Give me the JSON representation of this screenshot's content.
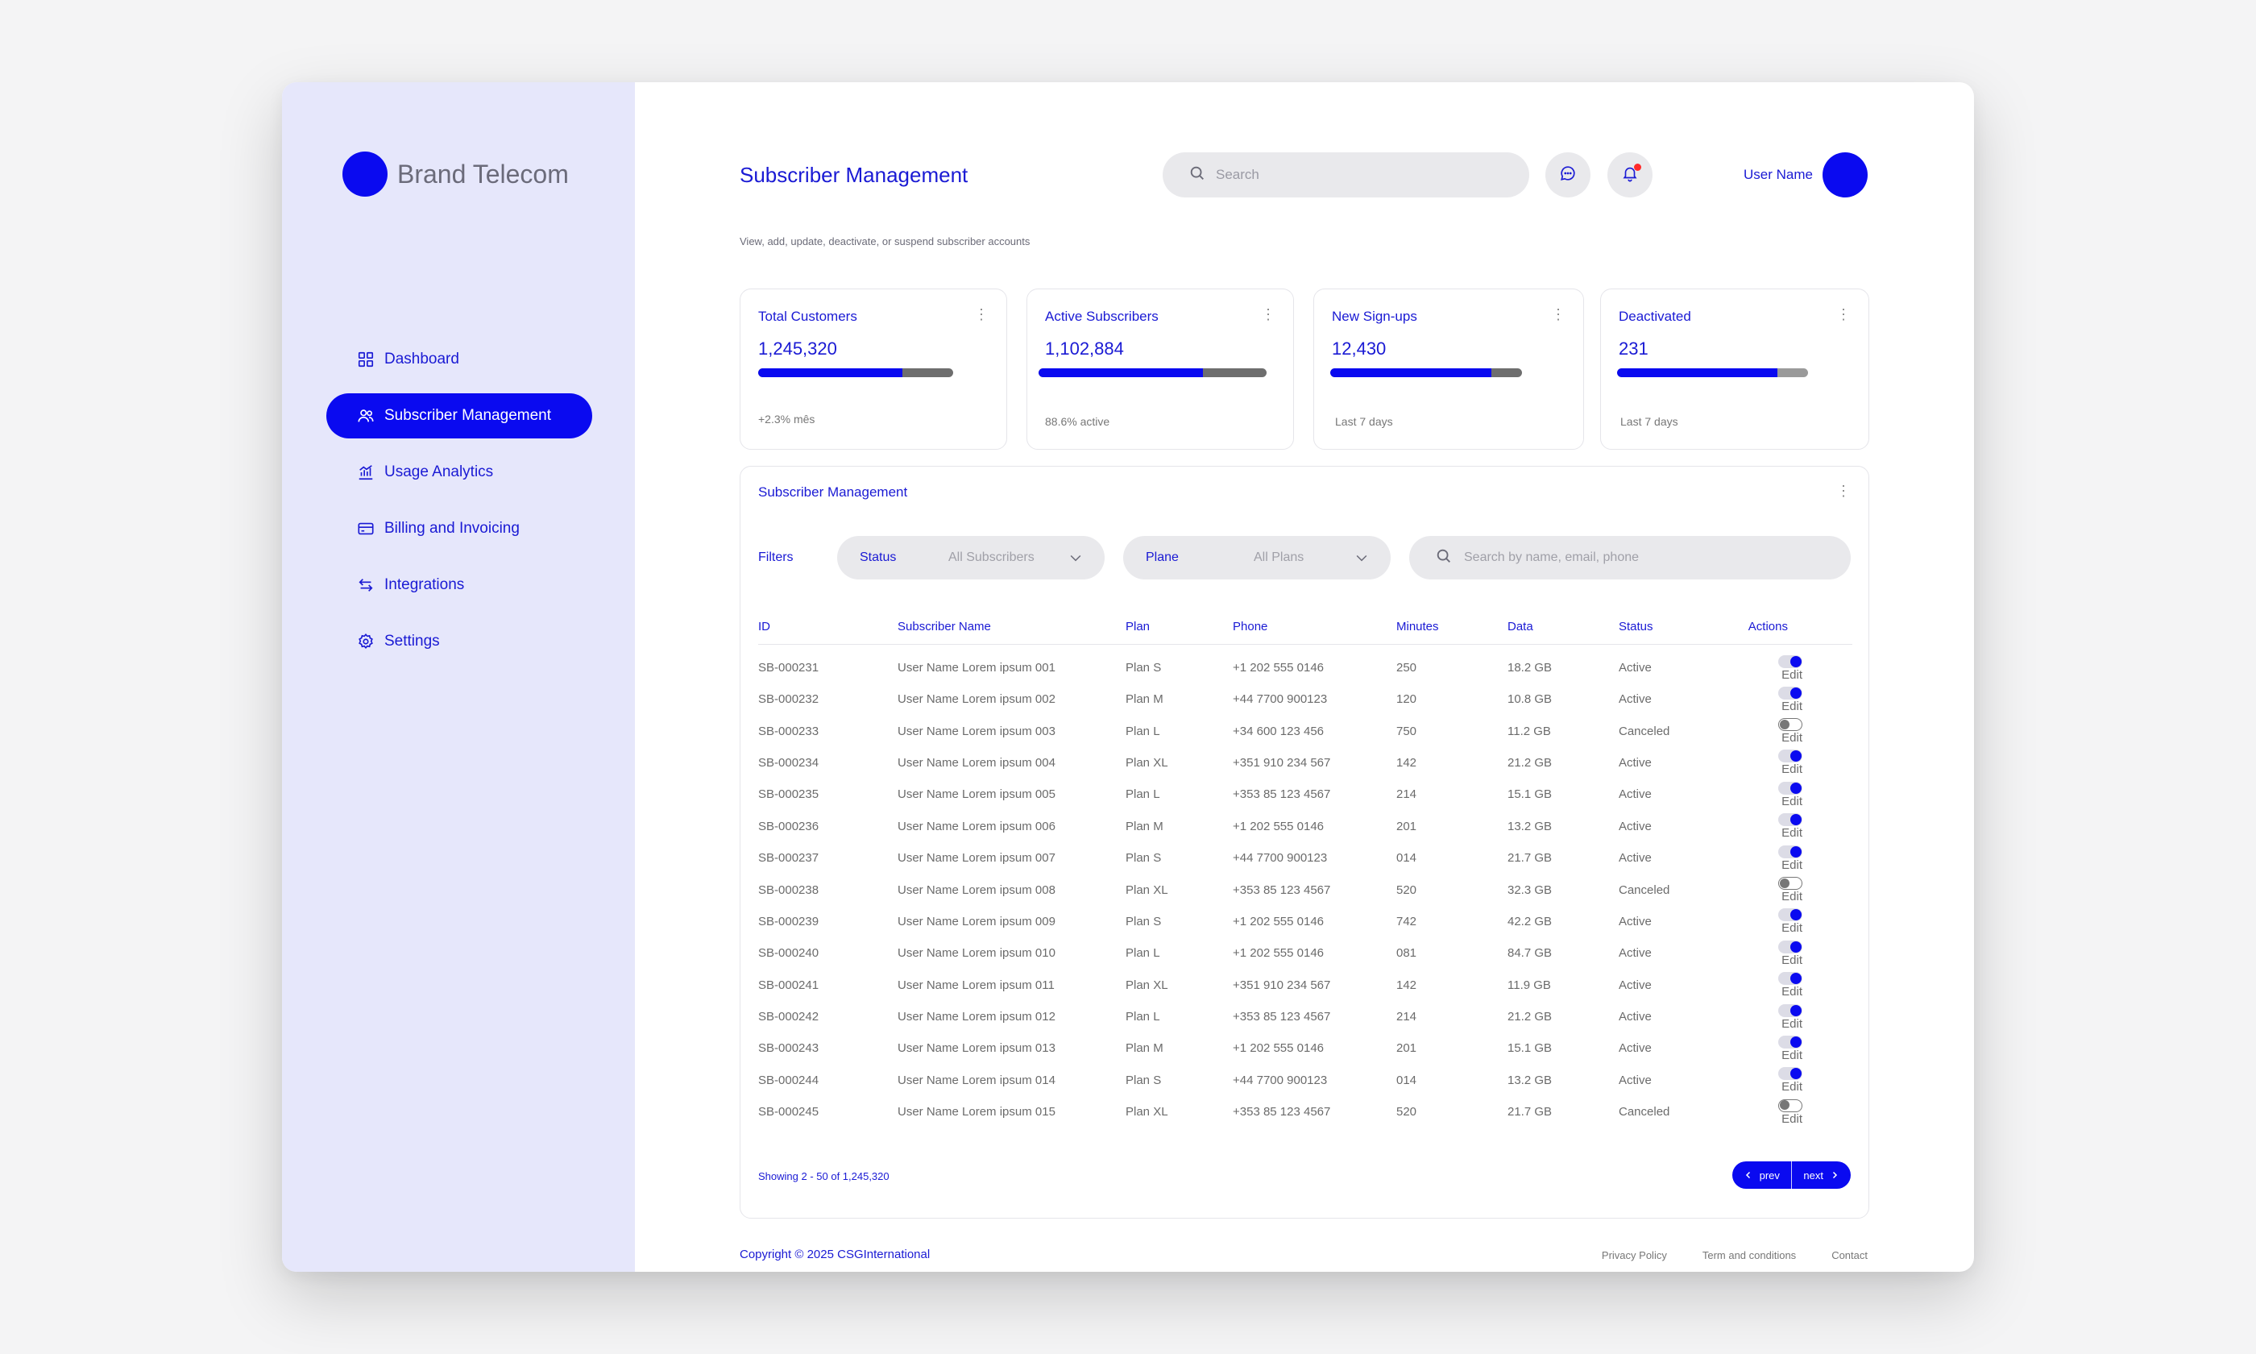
{
  "brand": {
    "name": "Brand Telecom"
  },
  "nav": [
    {
      "label": "Dashboard",
      "icon": "grid-icon",
      "active": false
    },
    {
      "label": "Subscriber Management",
      "icon": "users-icon",
      "active": true
    },
    {
      "label": "Usage Analytics",
      "icon": "chart-icon",
      "active": false
    },
    {
      "label": "Billing and Invoicing",
      "icon": "card-icon",
      "active": false
    },
    {
      "label": "Integrations",
      "icon": "swap-icon",
      "active": false
    },
    {
      "label": "Settings",
      "icon": "gear-icon",
      "active": false
    }
  ],
  "header": {
    "title": "Subscriber Management",
    "subtitle": "View, add, update, deactivate, or suspend subscriber accounts",
    "search_placeholder": "Search",
    "user_name": "User Name"
  },
  "cards": [
    {
      "title": "Total Customers",
      "value": "1,245,320",
      "progress": 0.74,
      "foot": "+2.3% mês"
    },
    {
      "title": "Active Subscribers",
      "value": "1,102,884",
      "progress": 0.72,
      "foot": "88.6% active"
    },
    {
      "title": "New Sign-ups",
      "value": "12,430",
      "progress": 0.84,
      "foot": "Last 7 days"
    },
    {
      "title": "Deactivated",
      "value": "231",
      "progress": 0.84,
      "foot": "Last 7 days"
    }
  ],
  "panel": {
    "title": "Subscriber Management",
    "filters_label": "Filters",
    "status_label": "Status",
    "status_value": "All Subscribers",
    "plan_label": "Plane",
    "plan_value": "All Plans",
    "search_placeholder": "Search by name, email, phone",
    "columns": [
      "ID",
      "Subscriber Name",
      "Plan",
      "Phone",
      "Minutes",
      "Data",
      "Status",
      "Actions"
    ],
    "edit_label": "Edit",
    "rows": [
      {
        "id": "SB-000231",
        "name": "User Name Lorem ipsum 001",
        "plan": "Plan S",
        "phone": "+1 202 555 0146",
        "minutes": "250",
        "data": "18.2 GB",
        "status": "Active",
        "on": true
      },
      {
        "id": "SB-000232",
        "name": "User Name Lorem ipsum 002",
        "plan": "Plan M",
        "phone": "+44 7700 900123",
        "minutes": "120",
        "data": "10.8 GB",
        "status": "Active",
        "on": true
      },
      {
        "id": "SB-000233",
        "name": "User Name Lorem ipsum 003",
        "plan": "Plan L",
        "phone": "+34 600 123 456",
        "minutes": "750",
        "data": "11.2 GB",
        "status": "Canceled",
        "on": false
      },
      {
        "id": "SB-000234",
        "name": "User Name Lorem ipsum 004",
        "plan": "Plan XL",
        "phone": "+351 910 234 567",
        "minutes": "142",
        "data": "21.2 GB",
        "status": "Active",
        "on": true
      },
      {
        "id": "SB-000235",
        "name": "User Name Lorem ipsum 005",
        "plan": "Plan L",
        "phone": "+353 85 123 4567",
        "minutes": "214",
        "data": "15.1 GB",
        "status": "Active",
        "on": true
      },
      {
        "id": "SB-000236",
        "name": "User Name Lorem ipsum 006",
        "plan": "Plan M",
        "phone": "+1 202 555 0146",
        "minutes": "201",
        "data": "13.2 GB",
        "status": "Active",
        "on": true
      },
      {
        "id": "SB-000237",
        "name": "User Name Lorem ipsum 007",
        "plan": "Plan S",
        "phone": "+44 7700 900123",
        "minutes": "014",
        "data": "21.7 GB",
        "status": "Active",
        "on": true
      },
      {
        "id": "SB-000238",
        "name": "User Name Lorem ipsum 008",
        "plan": "Plan XL",
        "phone": "+353 85 123 4567",
        "minutes": "520",
        "data": "32.3 GB",
        "status": "Canceled",
        "on": false
      },
      {
        "id": "SB-000239",
        "name": "User Name Lorem ipsum 009",
        "plan": "Plan S",
        "phone": "+1 202 555 0146",
        "minutes": "742",
        "data": "42.2 GB",
        "status": "Active",
        "on": true
      },
      {
        "id": "SB-000240",
        "name": "User Name Lorem ipsum 010",
        "plan": "Plan L",
        "phone": "+1 202 555 0146",
        "minutes": "081",
        "data": "84.7 GB",
        "status": "Active",
        "on": true
      },
      {
        "id": "SB-000241",
        "name": "User Name Lorem ipsum 011",
        "plan": "Plan XL",
        "phone": "+351 910 234 567",
        "minutes": "142",
        "data": "11.9 GB",
        "status": "Active",
        "on": true
      },
      {
        "id": "SB-000242",
        "name": "User Name Lorem ipsum 012",
        "plan": "Plan L",
        "phone": "+353 85 123 4567",
        "minutes": "214",
        "data": "21.2 GB",
        "status": "Active",
        "on": true
      },
      {
        "id": "SB-000243",
        "name": "User Name Lorem ipsum 013",
        "plan": "Plan M",
        "phone": "+1 202 555 0146",
        "minutes": "201",
        "data": "15.1 GB",
        "status": "Active",
        "on": true
      },
      {
        "id": "SB-000244",
        "name": "User Name Lorem ipsum 014",
        "plan": "Plan S",
        "phone": "+44 7700 900123",
        "minutes": "014",
        "data": "13.2 GB",
        "status": "Active",
        "on": true
      },
      {
        "id": "SB-000245",
        "name": "User Name Lorem ipsum 015",
        "plan": "Plan XL",
        "phone": "+353 85 123 4567",
        "minutes": "520",
        "data": "21.7 GB",
        "status": "Canceled",
        "on": false
      }
    ],
    "showing": "Showing 2 - 50 of 1,245,320",
    "prev_label": "prev",
    "next_label": "next"
  },
  "footer": {
    "copyright": "Copyright © 2025 CSGInternational",
    "links": [
      "Privacy Policy",
      "Term and conditions",
      "Contact"
    ]
  },
  "colors": {
    "accent": "#0a0af0",
    "sidebar_bg": "#e6e7fb",
    "text_accent": "#1a1ad4"
  }
}
